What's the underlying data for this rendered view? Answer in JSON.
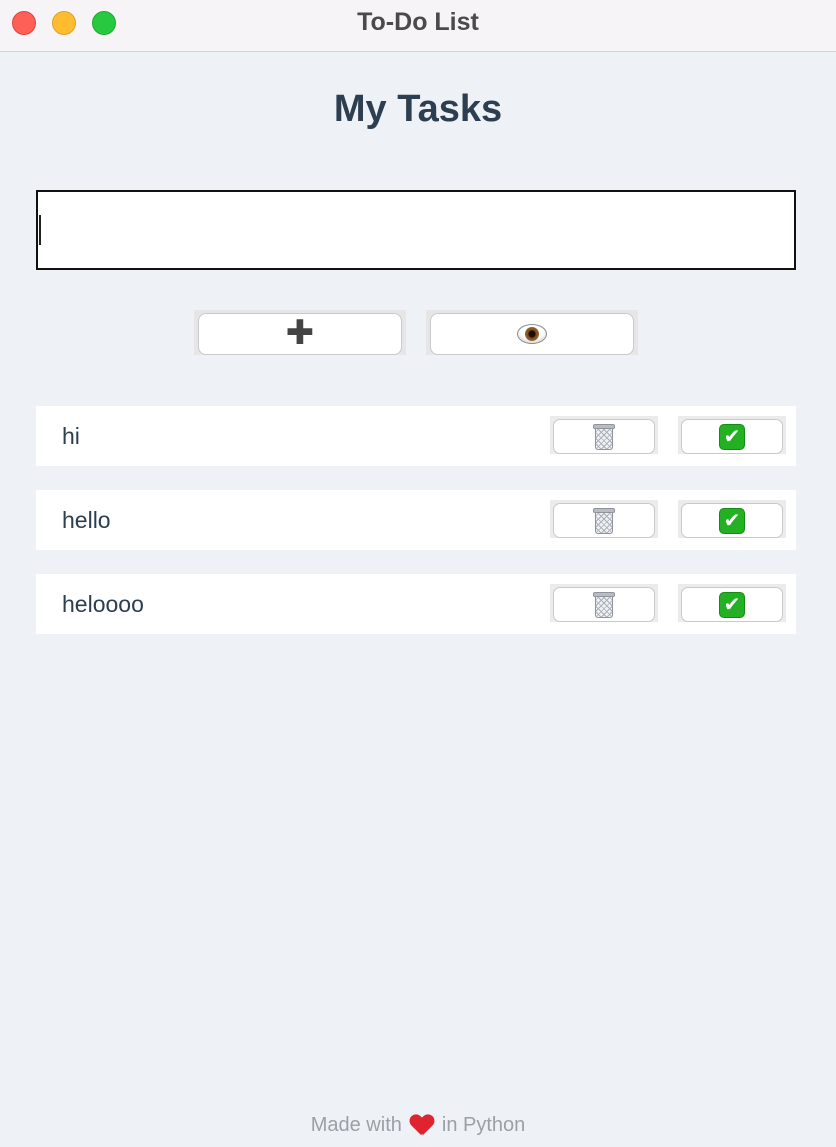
{
  "window": {
    "title": "To-Do List",
    "controls": [
      "close",
      "minimize",
      "maximize"
    ]
  },
  "header": {
    "title": "My Tasks"
  },
  "input": {
    "value": "",
    "placeholder": ""
  },
  "actions": {
    "add_icon": "plus-icon",
    "view_icon": "eye-icon"
  },
  "tasks": [
    {
      "text": "hi",
      "delete_icon": "trash-icon",
      "complete_icon": "check-icon"
    },
    {
      "text": "hello",
      "delete_icon": "trash-icon",
      "complete_icon": "check-icon"
    },
    {
      "text": "heloooo",
      "delete_icon": "trash-icon",
      "complete_icon": "check-icon"
    }
  ],
  "footer": {
    "prefix": "Made with",
    "suffix": "in Python",
    "heart_icon": "heart-icon"
  },
  "colors": {
    "background": "#eef2f7",
    "title": "#2c3e50",
    "check": "#23b022",
    "heart": "#e0242f"
  }
}
